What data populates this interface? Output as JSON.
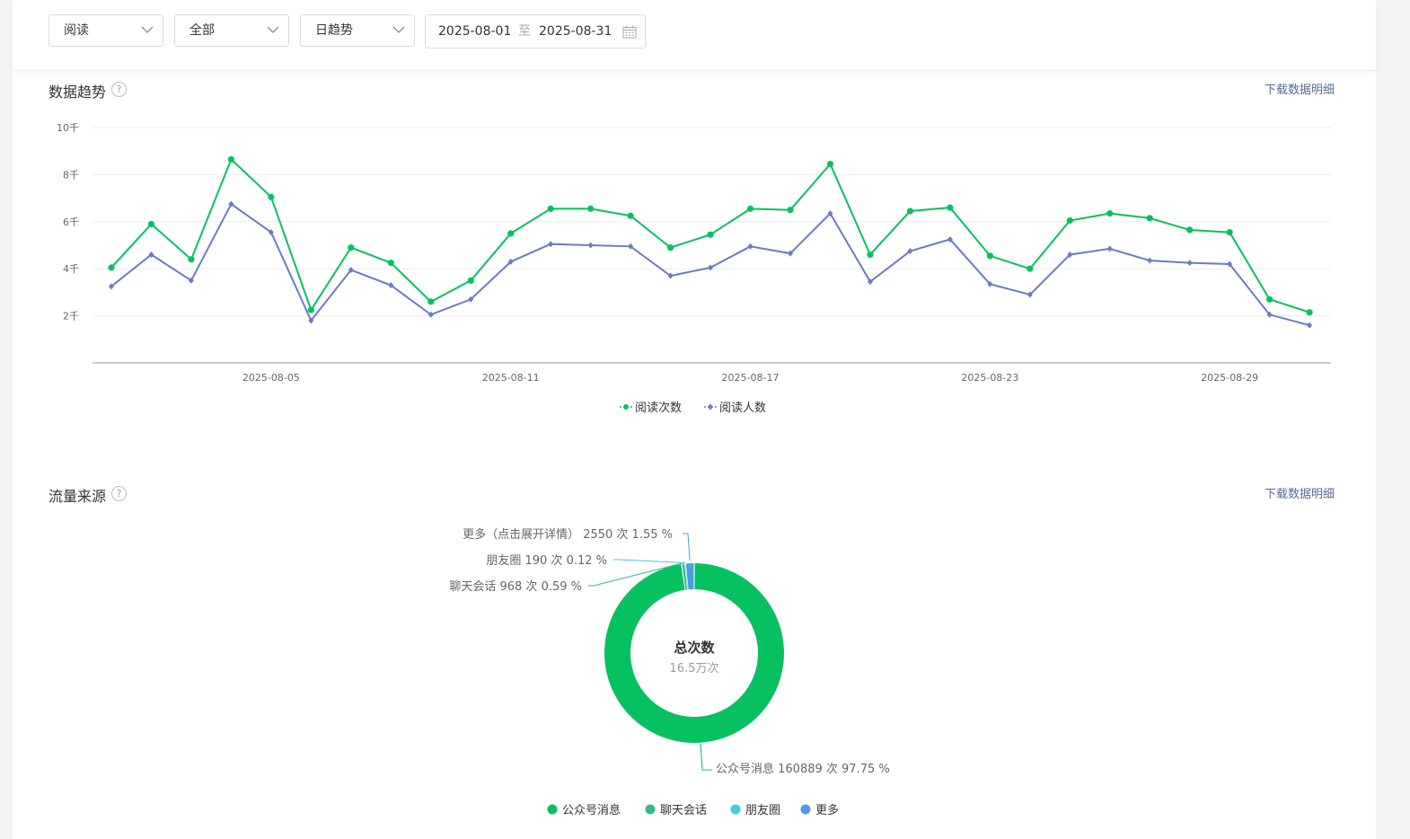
{
  "filters": {
    "metric": "阅读",
    "scope": "全部",
    "granularity": "日趋势",
    "date_start": "2025-08-01",
    "date_sep": "至",
    "date_end": "2025-08-31"
  },
  "trend_section": {
    "title": "数据趋势",
    "help": "?",
    "download": "下载数据明细"
  },
  "source_section": {
    "title": "流量来源",
    "help": "?",
    "download": "下载数据明细",
    "center_title": "总次数",
    "center_value": "16.5万次"
  },
  "colors": {
    "green": "#07c160",
    "blue": "#6b7cc0",
    "teal": "#3bb58f",
    "cyan": "#45c8e0",
    "skyblue": "#4d9de0"
  },
  "chart_data": [
    {
      "type": "line",
      "y_tick_labels": [
        "2千",
        "4千",
        "6千",
        "8千",
        "10千"
      ],
      "y_ticks": [
        2000,
        4000,
        6000,
        8000,
        10000
      ],
      "ylim": [
        0,
        10000
      ],
      "x_tick_labels": [
        "2025-08-05",
        "2025-08-11",
        "2025-08-17",
        "2025-08-23",
        "2025-08-29"
      ],
      "x_tick_days": [
        5,
        11,
        17,
        23,
        29
      ],
      "x": [
        "2025-08-01",
        "2025-08-02",
        "2025-08-03",
        "2025-08-04",
        "2025-08-05",
        "2025-08-06",
        "2025-08-07",
        "2025-08-08",
        "2025-08-09",
        "2025-08-10",
        "2025-08-11",
        "2025-08-12",
        "2025-08-13",
        "2025-08-14",
        "2025-08-15",
        "2025-08-16",
        "2025-08-17",
        "2025-08-18",
        "2025-08-19",
        "2025-08-20",
        "2025-08-21",
        "2025-08-22",
        "2025-08-23",
        "2025-08-24",
        "2025-08-25",
        "2025-08-26",
        "2025-08-27",
        "2025-08-28",
        "2025-08-29",
        "2025-08-30",
        "2025-08-31"
      ],
      "grid": true,
      "legend_position": "bottom-center",
      "series": [
        {
          "name": "阅读次数",
          "color": "#07c160",
          "marker": "circle",
          "values": [
            4050,
            5900,
            4400,
            8650,
            7050,
            2250,
            4900,
            4250,
            2600,
            3500,
            5500,
            6550,
            6550,
            6250,
            4900,
            5450,
            6550,
            6500,
            8450,
            4600,
            6450,
            6600,
            4550,
            4000,
            6050,
            6350,
            6150,
            5650,
            5550,
            2700,
            2150
          ]
        },
        {
          "name": "阅读人数",
          "color": "#6b7cc0",
          "marker": "diamond",
          "values": [
            3250,
            4600,
            3500,
            6750,
            5550,
            1800,
            3950,
            3300,
            2050,
            2700,
            4300,
            5050,
            5000,
            4950,
            3700,
            4050,
            4950,
            4650,
            6350,
            3450,
            4750,
            5250,
            3350,
            2900,
            4600,
            4850,
            4350,
            4250,
            4200,
            2050,
            1600
          ]
        }
      ]
    },
    {
      "type": "pie",
      "donut": true,
      "slices": [
        {
          "name": "公众号消息",
          "value": 160889,
          "percent": 97.75,
          "color": "#07c160",
          "label": "公众号消息 160889 次 97.75 %"
        },
        {
          "name": "聊天会话",
          "value": 968,
          "percent": 0.59,
          "color": "#3bb58f",
          "label": "聊天会话 968 次 0.59 %"
        },
        {
          "name": "朋友圈",
          "value": 190,
          "percent": 0.12,
          "color": "#45c8e0",
          "label": "朋友圈 190 次 0.12 %"
        },
        {
          "name": "更多",
          "value": 2550,
          "percent": 1.55,
          "color": "#4d9de0",
          "label": "更多（点击展开详情） 2550 次 1.55 %"
        }
      ],
      "legend_position": "bottom-center"
    }
  ]
}
